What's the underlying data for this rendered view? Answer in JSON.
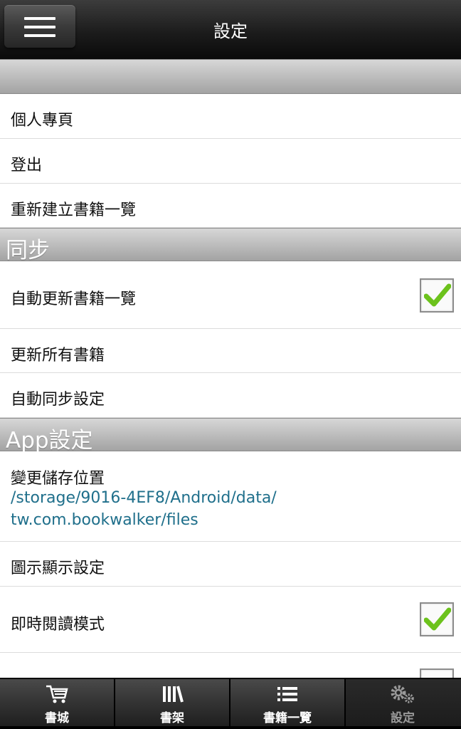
{
  "header": {
    "title": "設定"
  },
  "account": {
    "items": [
      {
        "label": "個人專頁"
      },
      {
        "label": "登出"
      },
      {
        "label": "重新建立書籍一覽"
      }
    ]
  },
  "sync": {
    "title": "同步",
    "items": [
      {
        "label": "自動更新書籍一覽",
        "checked": true
      },
      {
        "label": "更新所有書籍"
      },
      {
        "label": "自動同步設定"
      }
    ]
  },
  "app": {
    "title": "App設定",
    "storage_label": "變更儲存位置",
    "storage_path_line1": "/storage/9016-4EF8/Android/data/",
    "storage_path_line2": "tw.com.bookwalker/files",
    "icon_display_label": "圖示顯示設定",
    "instant_read_label": "即時閱讀模式",
    "instant_read_checked": true
  },
  "nav": {
    "tabs": [
      {
        "label": "書城",
        "icon": "cart-icon"
      },
      {
        "label": "書架",
        "icon": "bookshelf-icon"
      },
      {
        "label": "書籍一覽",
        "icon": "list-icon"
      },
      {
        "label": "設定",
        "icon": "gear-icon",
        "active": true
      }
    ]
  },
  "colors": {
    "check": "#6cc21c",
    "link": "#1f6f8b"
  }
}
